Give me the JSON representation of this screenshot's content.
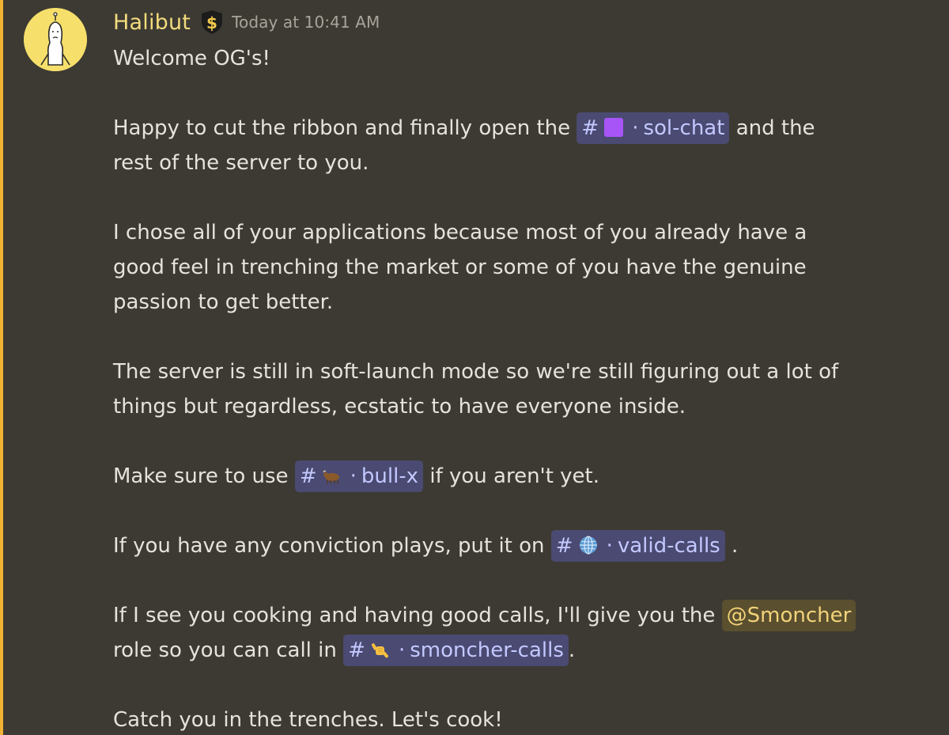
{
  "message": {
    "author": "Halibut",
    "timestamp": "Today at 10:41 AM",
    "role_icon": "dollar-shield-icon",
    "accent_color": "#f0b232",
    "lines": {
      "l1": "Welcome OG's!",
      "l2a": "Happy to cut the ribbon and finally open the ",
      "l2b": " and the",
      "l3": "rest of the server to you.",
      "l4": "I chose all of your applications because most of you already have a",
      "l5": "good feel in trenching the market or some of you have the genuine",
      "l6": "passion to get better.",
      "l7": "The server is still in soft-launch mode so we're still figuring out a lot of",
      "l8": "things but regardless, ecstatic to have everyone inside.",
      "l9a": "Make sure to use ",
      "l9b": " if you aren't yet.",
      "l10a": "If you have any conviction plays, put it on ",
      "l10b": " .",
      "l11a": "If I see you cooking and having good calls, I'll give you the ",
      "l12a": "role so you can call in ",
      "l12b": ".",
      "l13": "Catch you in the trenches. Let's cook!"
    },
    "channels": {
      "sol_chat": {
        "hash": "#",
        "emoji": "purple-square-icon",
        "dot": "·",
        "name": "sol-chat"
      },
      "bull_x": {
        "hash": "#",
        "emoji": "ox-icon",
        "dot": "·",
        "name": "bull-x"
      },
      "valid_calls": {
        "hash": "#",
        "emoji": "globe-icon",
        "dot": "·",
        "name": "valid-calls"
      },
      "smoncher_calls": {
        "hash": "#",
        "emoji": "call-me-hand-icon",
        "dot": "·",
        "name": "smoncher-calls"
      }
    },
    "role_mention": "@Smoncher"
  }
}
